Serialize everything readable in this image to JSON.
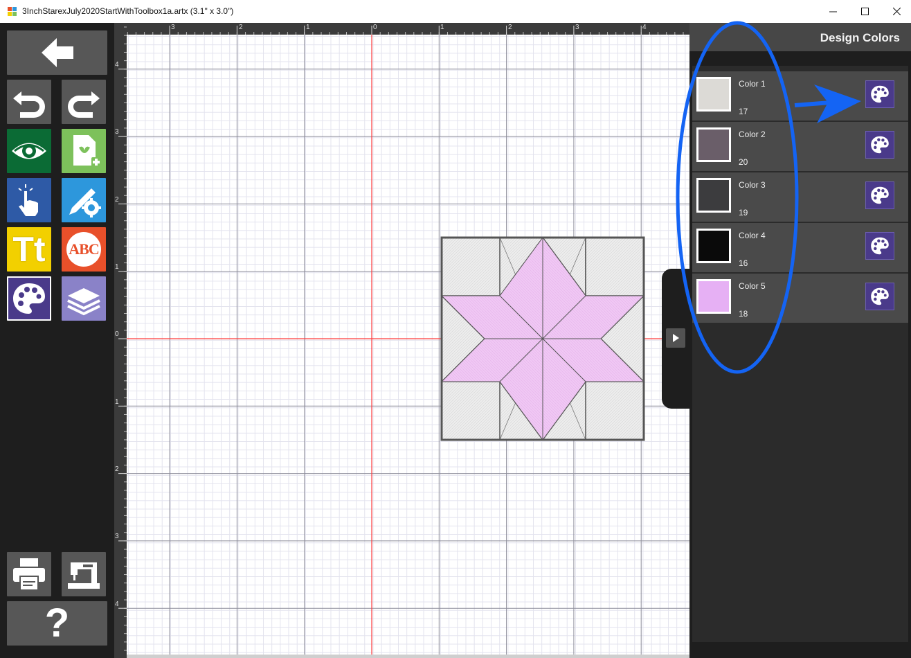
{
  "window": {
    "title": "3InchStarexJuly2020StartWithToolbox1a.artx (3.1\" x 3.0\")",
    "minimize_icon": "minimize-icon",
    "maximize_icon": "maximize-icon",
    "close_icon": "close-icon"
  },
  "toolbar": {
    "buttons": [
      {
        "name": "back",
        "icon": "arrow-left-icon"
      },
      {
        "name": "undo",
        "icon": "undo-icon"
      },
      {
        "name": "redo",
        "icon": "redo-icon"
      },
      {
        "name": "view",
        "icon": "eye-icon"
      },
      {
        "name": "add-design",
        "icon": "file-add-icon"
      },
      {
        "name": "select",
        "icon": "pointer-hand-icon"
      },
      {
        "name": "edit-tools",
        "icon": "pencil-gear-icon"
      },
      {
        "name": "text",
        "icon": "text-tt-icon",
        "label": "Tt"
      },
      {
        "name": "monogram",
        "icon": "monogram-abc-icon",
        "label": "ABC"
      },
      {
        "name": "design-colors",
        "icon": "palette-icon"
      },
      {
        "name": "layers",
        "icon": "layers-icon"
      },
      {
        "name": "print",
        "icon": "printer-icon"
      },
      {
        "name": "sew",
        "icon": "sewing-machine-icon"
      },
      {
        "name": "help",
        "icon": "help-icon",
        "label": "?"
      }
    ],
    "colors": {
      "gray": "#575757",
      "view": "#0b6b35",
      "add_design": "#7dc15b",
      "select": "#2e5aa6",
      "edit_tools": "#2d97dc",
      "text": "#f2d000",
      "monogram": "#e8502a",
      "design_colors": "#4a3a8a",
      "layers": "#8a82c8"
    }
  },
  "rulers": {
    "top": [
      "3",
      "2",
      "1",
      "0",
      "1",
      "2",
      "3",
      "4"
    ],
    "left": [
      "4",
      "3",
      "2",
      "1",
      "0",
      "1",
      "2",
      "3",
      "4"
    ]
  },
  "canvas": {
    "background": "#ffffff",
    "grid_major": "#8c8c99",
    "grid_minor": "#e3e3ee",
    "axis_color": "#ff3b3b"
  },
  "design": {
    "name": "eight-point-star-block",
    "colors": {
      "border": "#555555",
      "background": "#ededed",
      "star": "#f0c8f4"
    }
  },
  "panel": {
    "title": "Design Colors",
    "colors": [
      {
        "name": "Color 1",
        "number": "17",
        "hex": "#dcdad6"
      },
      {
        "name": "Color 2",
        "number": "20",
        "hex": "#6a5e69"
      },
      {
        "name": "Color 3",
        "number": "19",
        "hex": "#3c3c3e"
      },
      {
        "name": "Color 4",
        "number": "16",
        "hex": "#0a0a0a"
      },
      {
        "name": "Color 5",
        "number": "18",
        "hex": "#e6b0f4"
      }
    ],
    "palette_button_icon": "palette-icon",
    "collapse_icon": "chevron-right-icon"
  },
  "annotations": {
    "color": "#1464f4",
    "ellipse": "highlight-ellipse",
    "arrow": "pointer-arrow"
  }
}
